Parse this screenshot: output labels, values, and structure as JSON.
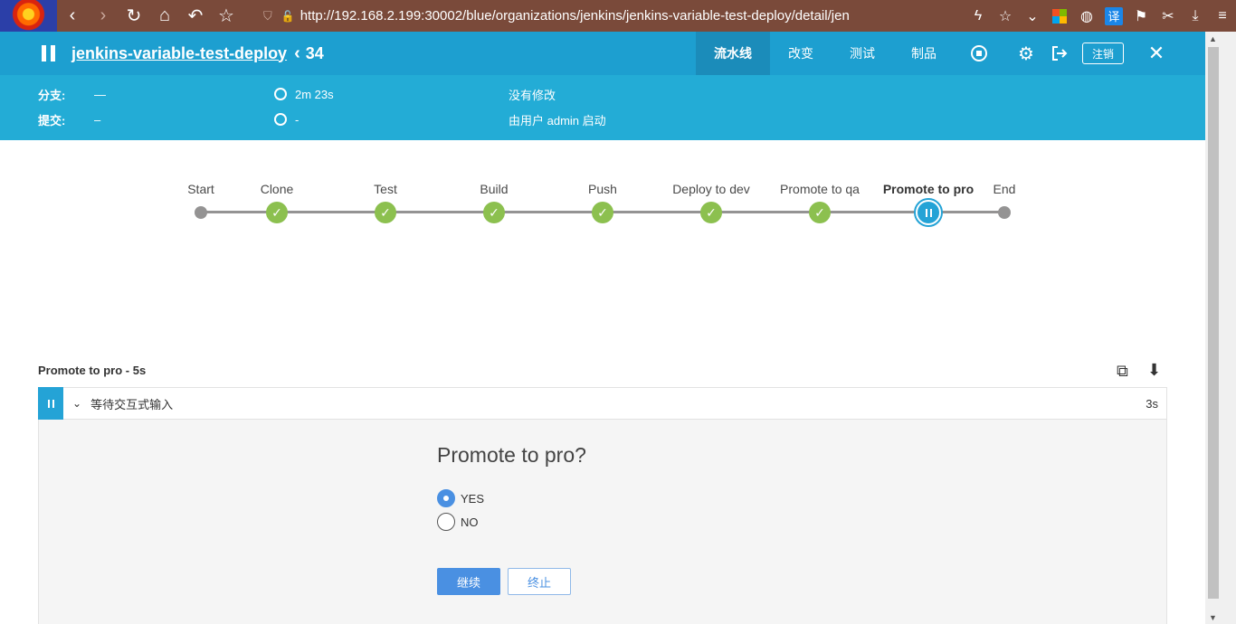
{
  "browser": {
    "url": "http://192.168.2.199:30002/blue/organizations/jenkins/jenkins-variable-test-deploy/detail/jen",
    "translate_label": "译"
  },
  "header": {
    "job_name": "jenkins-variable-test-deploy",
    "run_number": "34",
    "tabs": [
      {
        "label": "流水线",
        "active": true
      },
      {
        "label": "改变",
        "active": false
      },
      {
        "label": "测试",
        "active": false
      },
      {
        "label": "制品",
        "active": false
      }
    ],
    "logout_label": "注销"
  },
  "info": {
    "branch_label": "分支:",
    "branch_value": "—",
    "commit_label": "提交:",
    "commit_value": "–",
    "duration": "2m 23s",
    "time_ago": "-",
    "changes": "没有修改",
    "started_by": "由用户 admin 启动"
  },
  "pipeline": {
    "stages": [
      {
        "name": "Start",
        "status": "start"
      },
      {
        "name": "Clone",
        "status": "success"
      },
      {
        "name": "Test",
        "status": "success"
      },
      {
        "name": "Build",
        "status": "success"
      },
      {
        "name": "Push",
        "status": "success"
      },
      {
        "name": "Deploy to dev",
        "status": "success"
      },
      {
        "name": "Promote to qa",
        "status": "success"
      },
      {
        "name": "Promote to pro",
        "status": "paused"
      },
      {
        "name": "End",
        "status": "end"
      }
    ]
  },
  "step": {
    "title": "Promote to pro - 5s",
    "row_text": "等待交互式输入",
    "row_duration": "3s",
    "prompt": "Promote to pro?",
    "options": [
      {
        "label": "YES",
        "checked": true
      },
      {
        "label": "NO",
        "checked": false
      }
    ],
    "proceed_label": "继续",
    "abort_label": "终止"
  },
  "colors": {
    "header_bg": "#1d9fd0",
    "info_bg": "#23acd6",
    "success": "#8cc04f",
    "paused": "#24a3d6",
    "primary_button": "#4a90e2"
  }
}
